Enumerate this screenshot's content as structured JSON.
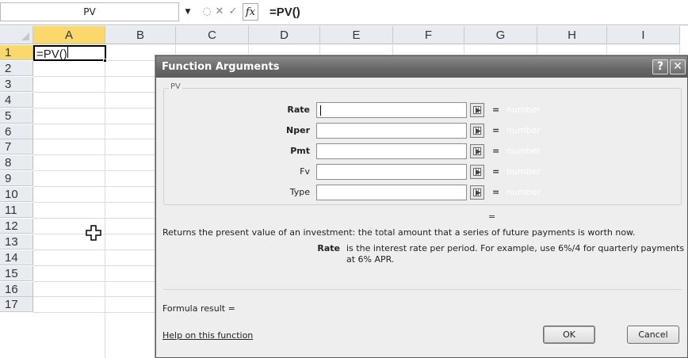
{
  "formula_bar": {
    "name_box": "PV",
    "dropdown_glyph": "▼",
    "cancel_glyph": "✕",
    "enter_glyph": "✓",
    "fx_label": "fx",
    "formula": "=PV()"
  },
  "sheet": {
    "columns": [
      "A",
      "B",
      "C",
      "D",
      "E",
      "F",
      "G",
      "H",
      "I"
    ],
    "rows": [
      "1",
      "2",
      "3",
      "4",
      "5",
      "6",
      "7",
      "8",
      "9",
      "10",
      "11",
      "12",
      "13",
      "14",
      "15",
      "16",
      "17"
    ],
    "active_cell": "A1",
    "cell_A1": "=PV()"
  },
  "dialog": {
    "title": "Function Arguments",
    "help_glyph": "?",
    "close_glyph": "✕",
    "group_label": "PV",
    "arguments": [
      {
        "label": "Rate",
        "hint": "number"
      },
      {
        "label": "Nper",
        "hint": "number"
      },
      {
        "label": "Pmt",
        "hint": "number"
      },
      {
        "label": "Fv",
        "hint": "number"
      },
      {
        "label": "Type",
        "hint": "number"
      }
    ],
    "equals": "=",
    "result_equals": "=",
    "description": "Returns the present value of an investment: the total amount that a series of future payments is worth now.",
    "current_arg_name": "Rate",
    "current_arg_description": "is the interest rate per period. For example, use 6%/4 for quarterly payments at 6% APR.",
    "formula_result_label": "Formula result =",
    "help_link": "Help on this function",
    "ok_label": "OK",
    "cancel_label": "Cancel"
  },
  "colors": {
    "header_bg": "#e8ecf1",
    "header_selected": "#fbd86b",
    "dialog_bg": "#eeeeee",
    "titlebar": "#666666"
  },
  "icons": [
    "dropdown-icon",
    "cancel-formula-icon",
    "enter-formula-icon",
    "insert-function-icon",
    "help-icon",
    "close-icon",
    "collapse-dialog-icon",
    "cell-cursor-icon"
  ]
}
